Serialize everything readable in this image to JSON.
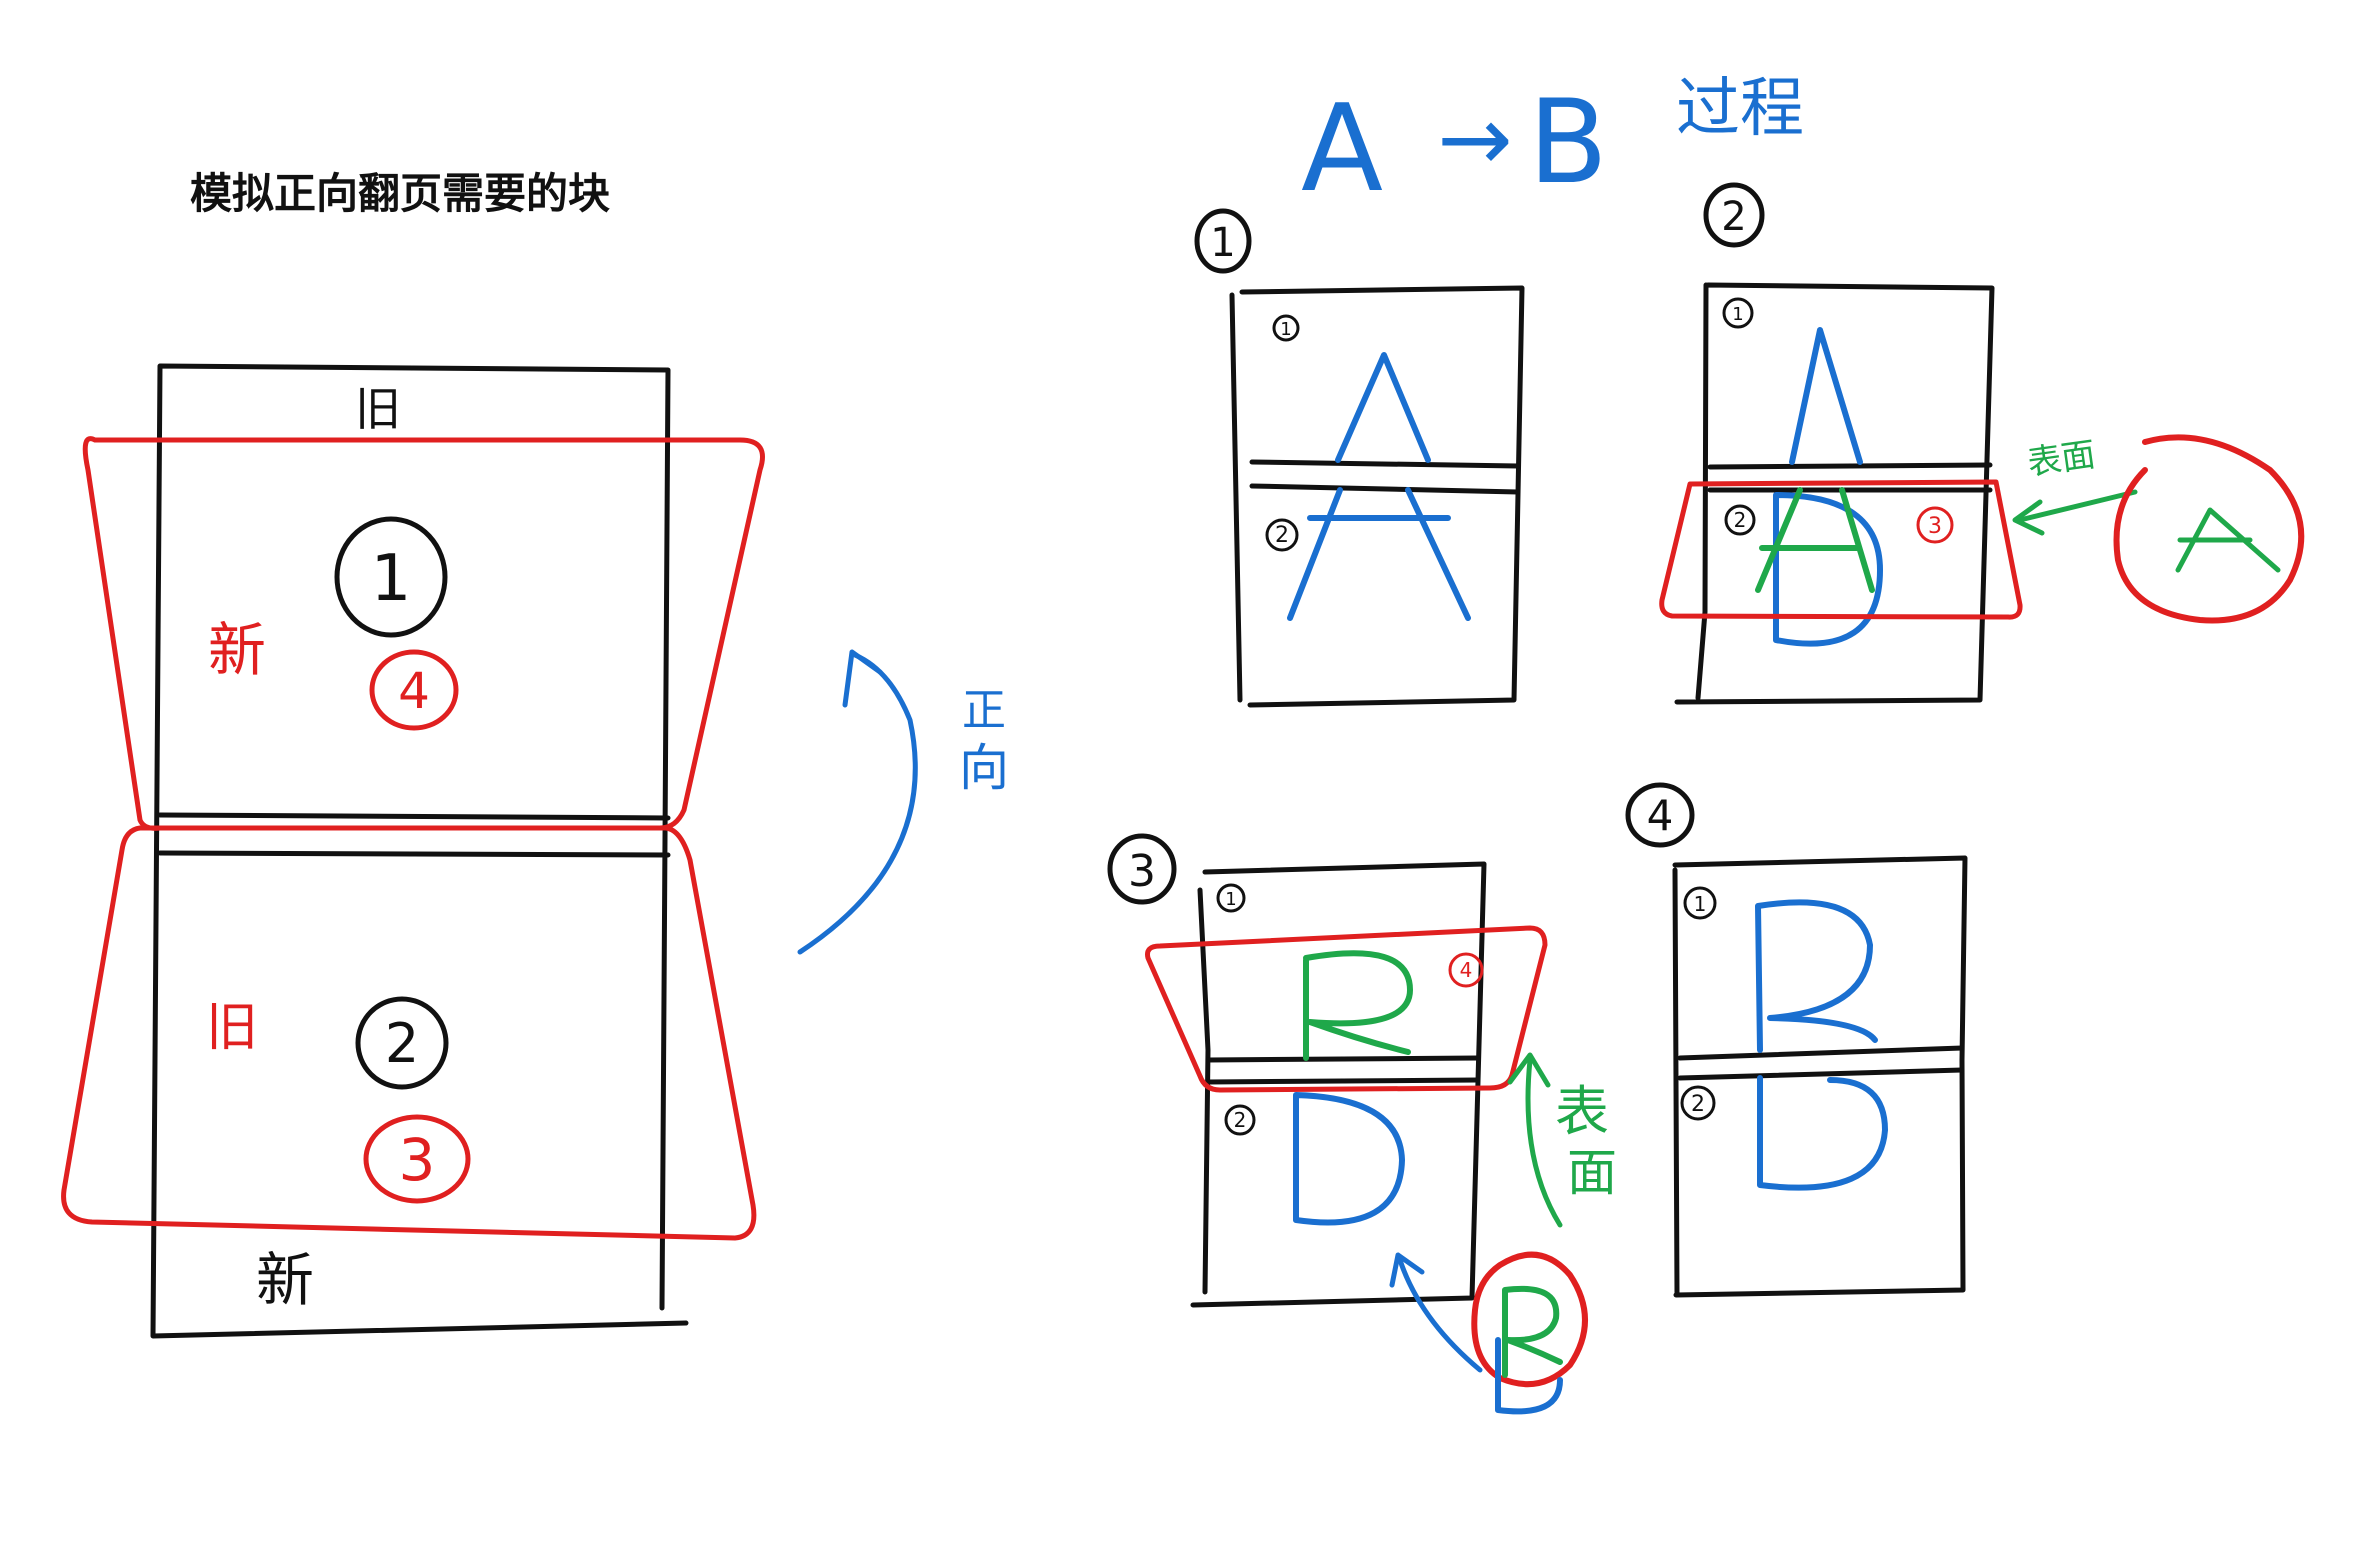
{
  "left": {
    "title": "模拟正向翻页需要的块",
    "label_old_top": "旧",
    "label_new_bottom": "新",
    "label_new_red": "新",
    "label_old_red": "旧",
    "num_1": "1",
    "num_2": "2",
    "num_3": "3",
    "num_4": "4",
    "arrow_label_1": "正",
    "arrow_label_2": "向"
  },
  "right": {
    "title_a": "A",
    "title_arrow": "→",
    "title_b": "B",
    "title_text": "过程",
    "steps": [
      {
        "num": "1",
        "top_num": "1",
        "bottom_num": "2",
        "top_letter": "A",
        "bottom_letter": "A"
      },
      {
        "num": "2",
        "top_num": "1",
        "bottom_num": "2",
        "top_letter": "A",
        "bottom_letter": "A",
        "red_num": "3",
        "surface_label": "表面",
        "circle_letter": "A"
      },
      {
        "num": "3",
        "top_num": "1",
        "bottom_num": "2",
        "top_letter": "B",
        "bottom_letter": "D",
        "red_num": "4",
        "surface_label": "表面",
        "circle_letter": "B"
      },
      {
        "num": "4",
        "top_num": "1",
        "bottom_num": "2",
        "top_letter": "B",
        "bottom_letter": "D"
      }
    ]
  },
  "colors": {
    "ink": "#111111",
    "red": "#e02020",
    "blue": "#1a6fd0",
    "green": "#1fa84a"
  }
}
